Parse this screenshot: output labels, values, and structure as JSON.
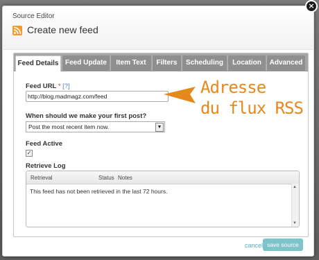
{
  "dialog": {
    "header_small": "Source Editor",
    "title": "Create new feed",
    "close_glyph": "×"
  },
  "tabs": [
    "Feed Details",
    "Feed Update",
    "Item Text",
    "Filters",
    "Scheduling",
    "Location",
    "Advanced"
  ],
  "active_tab": "Feed Details",
  "form": {
    "feed_url_label": "Feed URL",
    "feed_url_required": "*",
    "feed_url_help": "[?]",
    "feed_url_value": "http://blog.madmagz.com/feed",
    "first_post_label": "When should we make your first post?",
    "first_post_value": "Post the most recent item now.",
    "feed_active_label": "Feed Active",
    "feed_active_checked": true,
    "checkbox_glyph": "✓"
  },
  "log": {
    "title": "Retrieve Log",
    "columns": [
      "Retrieval",
      "Status",
      "Notes"
    ],
    "rows": [
      "This feed has not been retrieved in the last 72 hours."
    ]
  },
  "annotation": {
    "line1": "Adresse",
    "line2": "du flux RSS",
    "color": "#e5891d"
  },
  "footer": {
    "cancel_label": "cancel",
    "save_label": "save source"
  },
  "colors": {
    "accent": "#7fc4c9",
    "rss": "#f39a2b"
  }
}
